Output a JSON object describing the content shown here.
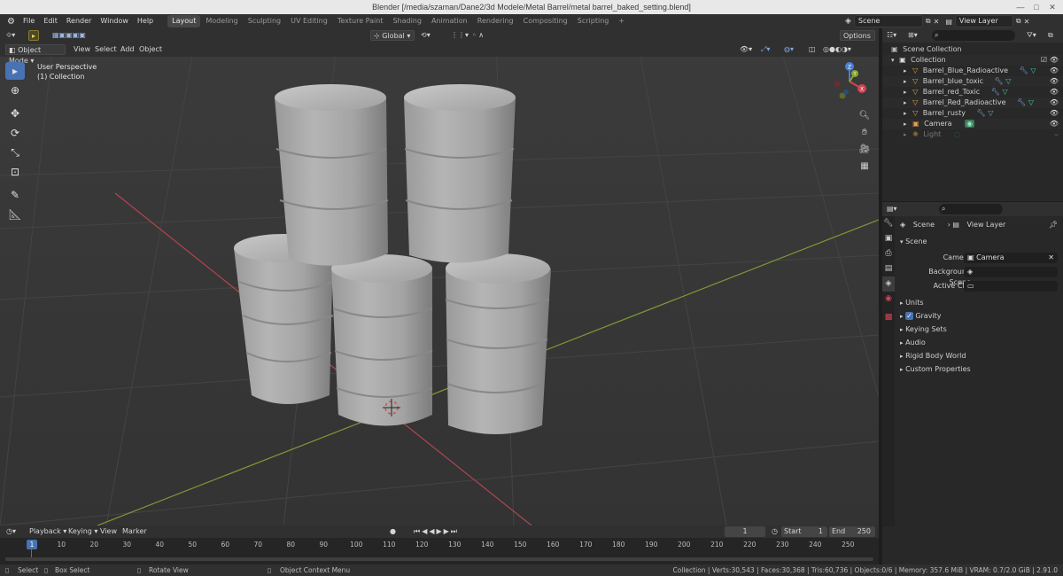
{
  "title": "Blender [/media/szaman/Dane2/3d Modele/Metal Barrel/metal barrel_baked_setting.blend]",
  "menus": [
    "File",
    "Edit",
    "Render",
    "Window",
    "Help"
  ],
  "workspaces": [
    "Layout",
    "Modeling",
    "Sculpting",
    "UV Editing",
    "Texture Paint",
    "Shading",
    "Animation",
    "Rendering",
    "Compositing",
    "Scripting"
  ],
  "active_workspace": "Layout",
  "top_right": {
    "scene": "Scene",
    "view_layer": "View Layer"
  },
  "viewport": {
    "mode": "Object Mode",
    "menus": [
      "View",
      "Select",
      "Add",
      "Object"
    ],
    "orientation": "Global",
    "options": "Options",
    "perspective": "User Perspective",
    "collection": "(1) Collection",
    "gizmo": {
      "z": "Z",
      "x": "X",
      "y": "Y"
    }
  },
  "outliner": {
    "root": "Scene Collection",
    "collection": "Collection",
    "items": [
      {
        "name": "Barrel_Blue_Radioactive",
        "type": "mesh"
      },
      {
        "name": "Barrel_blue_toxic",
        "type": "mesh"
      },
      {
        "name": "Barrel_red_Toxic",
        "type": "mesh"
      },
      {
        "name": "Barrel_Red_Radioactive",
        "type": "mesh"
      },
      {
        "name": "Barrel_rusty",
        "type": "mesh"
      },
      {
        "name": "Camera",
        "type": "camera"
      },
      {
        "name": "Light",
        "type": "light"
      }
    ]
  },
  "properties": {
    "breadcrumb_scene": "Scene",
    "breadcrumb_layer": "View Layer",
    "panel": "Scene",
    "camera_label": "Camera",
    "camera_value": "Camera",
    "bg_label": "Background Scene",
    "clip_label": "Active Clip",
    "subpanels": [
      "Units",
      "Gravity",
      "Keying Sets",
      "Audio",
      "Rigid Body World",
      "Custom Properties"
    ]
  },
  "timeline": {
    "menus": [
      "Playback",
      "Keying",
      "View",
      "Marker"
    ],
    "current_frame": "1",
    "start_label": "Start",
    "start": "1",
    "end_label": "End",
    "end": "250",
    "ticks": [
      "1",
      "10",
      "20",
      "30",
      "40",
      "50",
      "60",
      "70",
      "80",
      "90",
      "100",
      "110",
      "120",
      "130",
      "140",
      "150",
      "160",
      "170",
      "180",
      "190",
      "200",
      "210",
      "220",
      "230",
      "240",
      "250"
    ]
  },
  "status": {
    "select": "Select",
    "box_select": "Box Select",
    "rotate": "Rotate View",
    "context": "Object Context Menu",
    "stats": "Collection | Verts:30,543 | Faces:30,368 | Tris:60,736 | Objects:0/6 | Memory: 357.6 MiB | VRAM: 0.7/2.0 GiB | 2.91.0"
  },
  "colors": {
    "accent": "#4772b3",
    "x_axis": "#d14653",
    "y_axis": "#86a733",
    "z_axis": "#4d7fd0",
    "mesh_icon": "#e5a14d",
    "data_icon": "#47c9a0"
  }
}
